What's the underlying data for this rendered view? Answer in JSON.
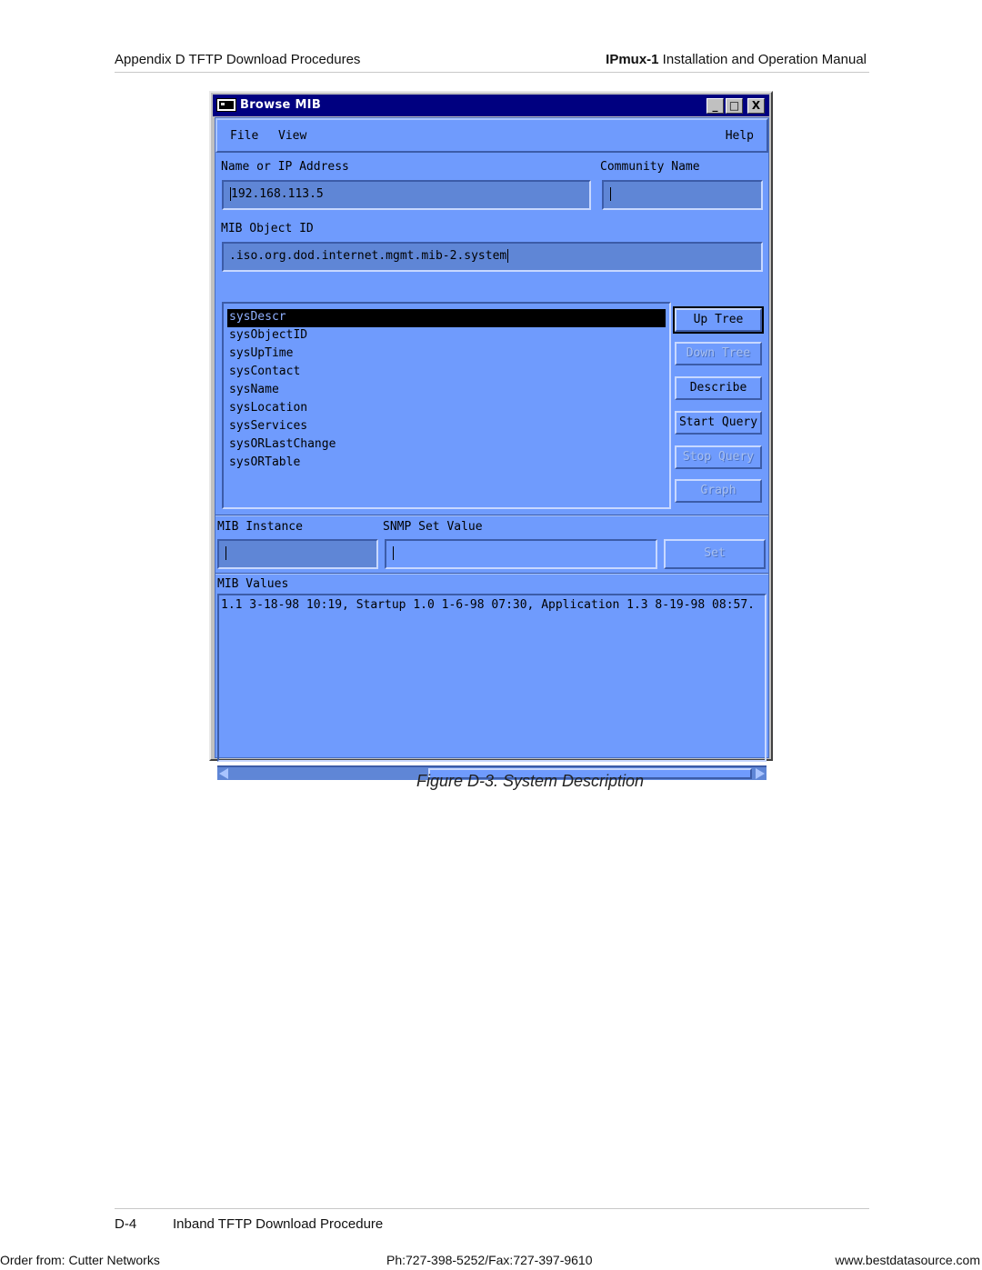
{
  "page_header": {
    "left": "Appendix D  TFTP Download Procedures",
    "right_bold": "IPmux-1",
    "right_rest": " Installation and Operation Manual"
  },
  "window": {
    "title": "Browse MIB",
    "title_icon": "terminal-icon",
    "controls": {
      "minimize": "_",
      "maximize": "□",
      "close": "X"
    },
    "menu": {
      "file": "File",
      "view": "View",
      "help": "Help"
    },
    "name_ip_label": "Name or IP Address",
    "name_ip_value": "192.168.113.5",
    "community_label": "Community Name",
    "community_value": "",
    "mib_oid_label": "MIB Object ID",
    "mib_oid_value": ".iso.org.dod.internet.mgmt.mib-2.system",
    "mib_list": {
      "items": [
        "sysDescr",
        "sysObjectID",
        "sysUpTime",
        "sysContact",
        "sysName",
        "sysLocation",
        "sysServices",
        "sysORLastChange",
        "sysORTable"
      ],
      "selected_index": 0
    },
    "buttons": {
      "up_tree": "Up Tree",
      "down_tree": "Down Tree",
      "describe": "Describe",
      "start_query": "Start Query",
      "stop_query": "Stop Query",
      "graph": "Graph",
      "set": "Set"
    },
    "mib_instance_label": "MIB Instance",
    "mib_instance_value": "",
    "snmp_set_label": "SNMP Set Value",
    "snmp_set_value": "",
    "mib_values_label": "MIB Values",
    "mib_values_text": "1.1 3-18-98 10:19, Startup 1.0 1-6-98 07:30, Application 1.3 8-19-98 08:57.",
    "colors": {
      "title_bar": "#000080",
      "panel": "#6f9bfd",
      "field": "#5f86d6"
    }
  },
  "caption": "Figure D-3.  System Description",
  "footer": {
    "page_number": "D-4",
    "section_title": "Inband TFTP Download Procedure",
    "order_from": "Order from: Cutter Networks",
    "phone_fax": "Ph:727-398-5252/Fax:727-397-9610",
    "website": "www.bestdatasource.com"
  }
}
